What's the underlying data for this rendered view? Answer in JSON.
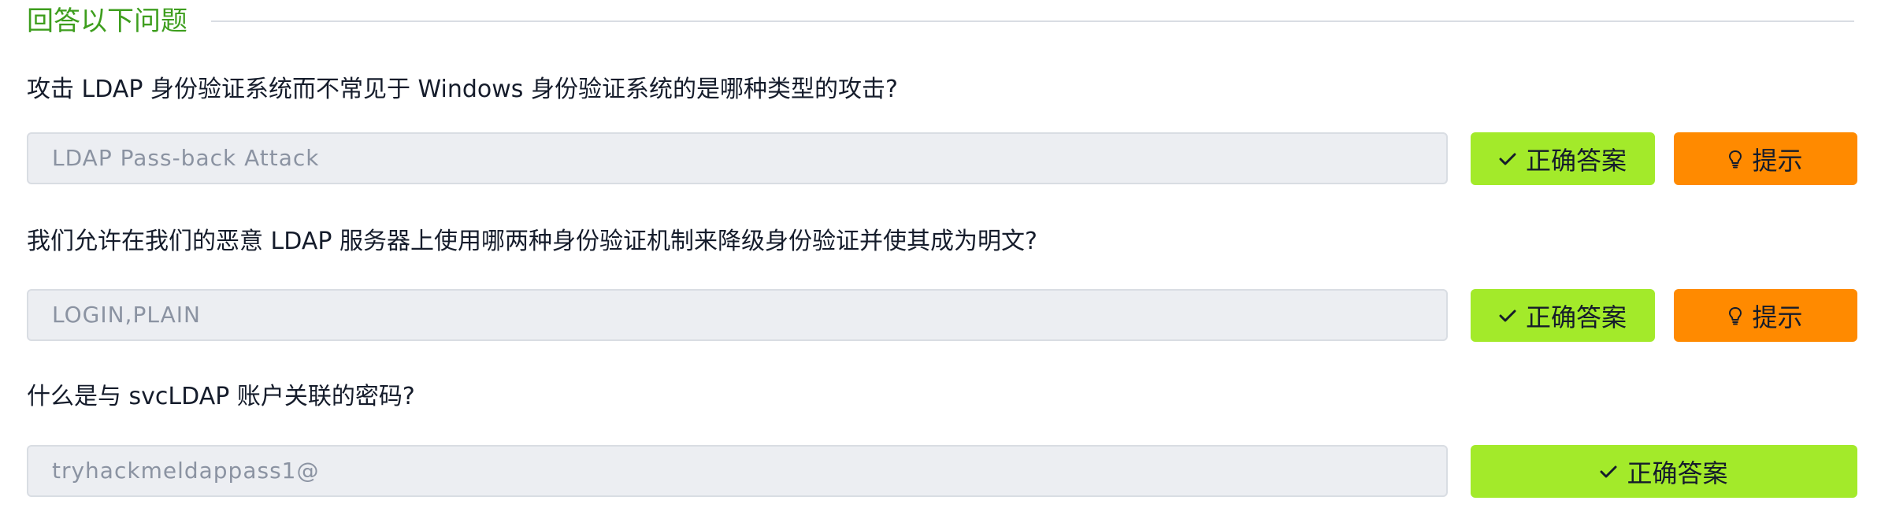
{
  "section": {
    "title": "回答以下问题"
  },
  "questions": [
    {
      "text": "攻击 LDAP 身份验证系统而不常见于 Windows 身份验证系统的是哪种类型的攻击?",
      "answer": "LDAP Pass-back Attack",
      "correct_label": "正确答案",
      "hint_label": "提示"
    },
    {
      "text": "我们允许在我们的恶意 LDAP 服务器上使用哪两种身份验证机制来降级身份验证并使其成为明文?",
      "answer": "LOGIN,PLAIN",
      "correct_label": "正确答案",
      "hint_label": "提示"
    },
    {
      "text": "什么是与 svcLDAP 账户关联的密码?",
      "answer": "tryhackmeldappass1@",
      "correct_label": "正确答案"
    }
  ],
  "colors": {
    "accent_green_text": "#3e9e1e",
    "correct_button": "#a3ea2a",
    "hint_button": "#ff8a00",
    "input_bg": "#eceef2"
  },
  "icons": {
    "correct": "check-icon",
    "hint": "lightbulb-icon"
  }
}
